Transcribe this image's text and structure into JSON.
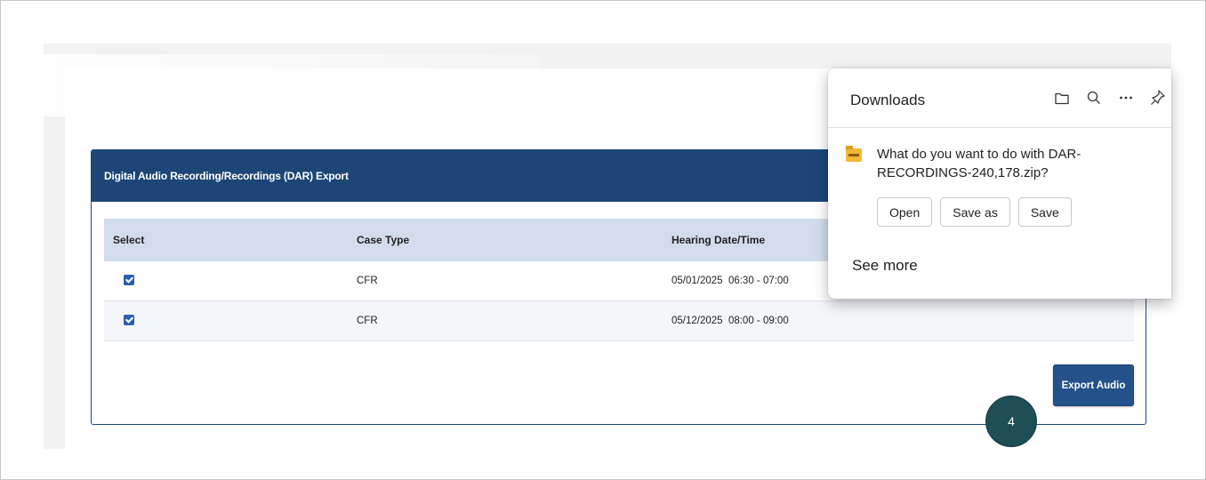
{
  "panel": {
    "title": "Digital Audio Recording/Recordings (DAR) Export"
  },
  "table": {
    "headers": [
      "Select",
      "Case Type",
      "Hearing Date/Time"
    ],
    "rows": [
      {
        "selected": true,
        "case_type": "CFR",
        "hearing": "05/01/2025  06:30 - 07:00"
      },
      {
        "selected": true,
        "case_type": "CFR",
        "hearing": "05/12/2025  08:00 - 09:00"
      }
    ]
  },
  "actions": {
    "export_label": "Export Audio"
  },
  "step_badge": "4",
  "downloads": {
    "title": "Downloads",
    "icons": [
      "folder-icon",
      "search-icon",
      "more-icon",
      "pin-icon"
    ],
    "question": "What do you want to do with DAR-RECORDINGS-240,178.zip?",
    "buttons": {
      "open": "Open",
      "save_as": "Save as",
      "save": "Save"
    },
    "see_more": "See more"
  },
  "colors": {
    "header_bg": "#1d4677",
    "table_header_bg": "#d2dcea",
    "button_bg": "#24518a",
    "badge_bg": "#1e4f57"
  }
}
